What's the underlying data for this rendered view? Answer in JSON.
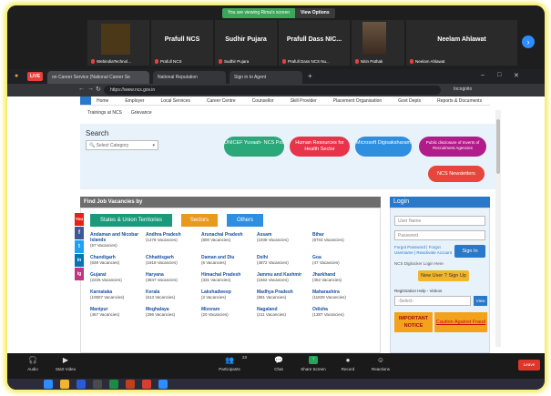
{
  "zoom": {
    "viewing_text": "You are viewing Rima's screen",
    "view_options": "View Options",
    "participants": [
      {
        "name": "",
        "sub": "WebindiaTechnol..."
      },
      {
        "name": "Prafull NCS",
        "sub": "Prafull NCS"
      },
      {
        "name": "Sudhir Pujara",
        "sub": "Sudhir Pujara"
      },
      {
        "name": "Prafull Dass NIC...",
        "sub": "Prafull Dass NCS Nu..."
      },
      {
        "name": "",
        "sub": "Nitin Pathak"
      },
      {
        "name": "Neelam Ahlawat",
        "sub": "Neelam Ahlawat"
      }
    ],
    "toolbar": {
      "audio": "Audio",
      "video": "Start Video",
      "participants": "Participants",
      "participants_count": "23",
      "chat": "Chat",
      "share": "Share Screen",
      "record": "Record",
      "reactions": "Reactions",
      "leave": "Leave"
    }
  },
  "browser": {
    "live_badge": "LIVE",
    "tabs": [
      "on Career Service (National Career Se",
      "National Reputation",
      "Sign in to Agent"
    ],
    "url": "https://www.ncs.gov.in",
    "profile": "Incognito"
  },
  "site": {
    "nav": [
      "Home",
      "Employer",
      "Local Services",
      "Career Centre",
      "Counsellor",
      "Skill Provider",
      "Placement Organisation",
      "Govt Depts",
      "Reports & Documents"
    ],
    "nav2": [
      "Trainings at NCS",
      "Grievance"
    ],
    "search_title": "Search",
    "search_placeholder": "Select Category",
    "pills": [
      {
        "label": "UNICEF Yuvaah- NCS Poll",
        "color": "#2aa87a"
      },
      {
        "label": "Human Resources for Health Sector",
        "color": "#e8344a"
      },
      {
        "label": "Microsoft Digisaksharam",
        "color": "#2e8ee0"
      },
      {
        "label": "Public disclosure of Inverts of Recruitment Agencies",
        "color": "#b21c8a"
      },
      {
        "label": "NCS Newsletters",
        "color": "#e8453c"
      }
    ],
    "jobs_header": "Find Job Vacancies by",
    "filters": {
      "states": "States & Union Territories",
      "sectors": "Sectors",
      "others": "Others"
    },
    "states": [
      {
        "name": "Andaman and Nicobar Islands",
        "vac": "(57 Vacancies)"
      },
      {
        "name": "Andhra Pradesh",
        "vac": "(1478 Vacancies)"
      },
      {
        "name": "Arunachal Pradesh",
        "vac": "(800 Vacancies)"
      },
      {
        "name": "Assam",
        "vac": "(1938 Vacancies)"
      },
      {
        "name": "Bihar",
        "vac": "(8703 Vacancies)"
      },
      {
        "name": "Chandigarh",
        "vac": "(639 Vacancies)"
      },
      {
        "name": "Chhattisgarh",
        "vac": "(1918 Vacancies)"
      },
      {
        "name": "Daman and Diu",
        "vac": "(6 Vacancies)"
      },
      {
        "name": "Delhi",
        "vac": "(4872 Vacancies)"
      },
      {
        "name": "Goa",
        "vac": "(47 Vacancies)"
      },
      {
        "name": "Gujarat",
        "vac": "(2225 Vacancies)"
      },
      {
        "name": "Haryana",
        "vac": "(3847 Vacancies)"
      },
      {
        "name": "Himachal Pradesh",
        "vac": "(331 Vacancies)"
      },
      {
        "name": "Jammu and Kashmir",
        "vac": "(1562 Vacancies)"
      },
      {
        "name": "Jharkhand",
        "vac": "(462 Vacancies)"
      },
      {
        "name": "Karnataka",
        "vac": "(10807 Vacancies)"
      },
      {
        "name": "Kerala",
        "vac": "(613 Vacancies)"
      },
      {
        "name": "Lakshadweep",
        "vac": "(2 Vacancies)"
      },
      {
        "name": "Madhya Pradesh",
        "vac": "(881 Vacancies)"
      },
      {
        "name": "Maharashtra",
        "vac": "(11829 Vacancies)"
      },
      {
        "name": "Manipur",
        "vac": "(467 Vacancies)"
      },
      {
        "name": "Meghalaya",
        "vac": "(296 Vacancies)"
      },
      {
        "name": "Mizoram",
        "vac": "(20 Vacancies)"
      },
      {
        "name": "Nagaland",
        "vac": "(211 Vacancies)"
      },
      {
        "name": "Odisha",
        "vac": "(1387 Vacancies)"
      }
    ],
    "login": {
      "header": "Login",
      "user_placeholder": "User Name",
      "password_placeholder": "Password",
      "forgot": "Forgot Password | Forgot Username | Reactivate Account",
      "digilocker": "NCS Digilocker Login Here",
      "sign_in": "Sign In",
      "new_user": "New User ? Sign Up",
      "reg_help": "Registration Help - Videos",
      "reg_select": "-Select-",
      "view": "View",
      "important": "IMPORTANT NOTICE",
      "caution": "Caution Against Fraud"
    },
    "social": [
      "You",
      "f",
      "t",
      "in",
      "ig"
    ]
  }
}
